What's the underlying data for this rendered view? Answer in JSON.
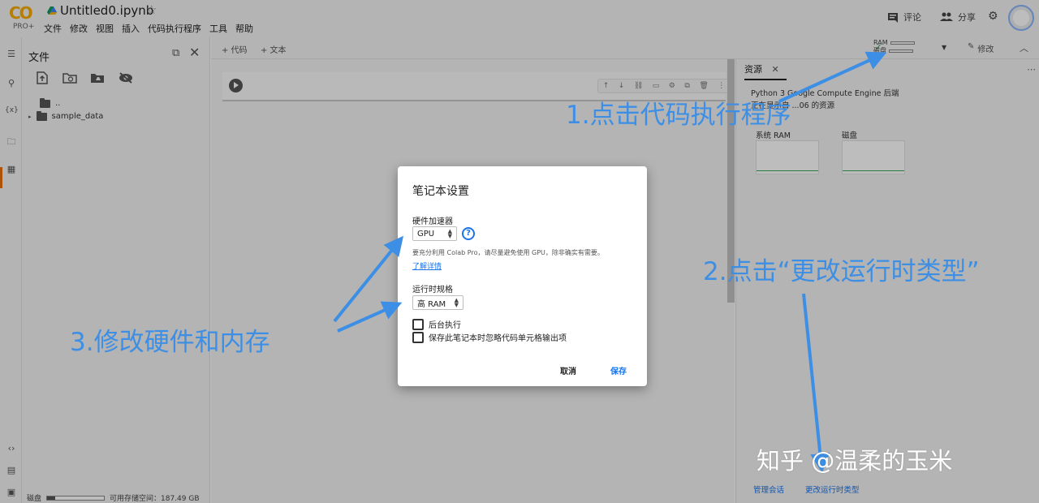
{
  "header": {
    "logo_text": "CO",
    "logo_badge": "PRO+",
    "doc_title": "Untitled0.ipynb",
    "menu": [
      "文件",
      "修改",
      "视图",
      "插入",
      "代码执行程序",
      "工具",
      "帮助"
    ],
    "comment_label": "评论",
    "share_label": "分享"
  },
  "toolbar": {
    "add_code": "+ 代码",
    "add_text": "+ 文本",
    "ram_label": "RAM",
    "disk_label": "磁盘",
    "edit_label": "修改"
  },
  "files_panel": {
    "title": "文件",
    "items": [
      {
        "label": ".."
      },
      {
        "label": "sample_data"
      }
    ],
    "disk_label": "磁盘",
    "disk_available": "可用存储空间：187.49 GB"
  },
  "resources_panel": {
    "tab_label": "资源",
    "description_line1": "Python 3 Google Compute Engine 后端",
    "description_line2": "正在显示自 ...06 的资源",
    "ram_label": "系统 RAM",
    "disk_label": "磁盘",
    "manage_sessions": "管理会话",
    "change_runtime": "更改运行时类型"
  },
  "dialog": {
    "title": "笔记本设置",
    "hw_label": "硬件加速器",
    "hw_value": "GPU",
    "note": "要充分利用 Colab Pro，请尽量避免使用 GPU，除非确实有需要。",
    "learn_more": "了解详情",
    "runtime_label": "运行时规格",
    "runtime_value": "高 RAM",
    "background_label": "后台执行",
    "omit_output_label": "保存此笔记本时忽略代码单元格输出项",
    "cancel_label": "取消",
    "save_label": "保存"
  },
  "annotations": {
    "step1": "1.点击代码执行程序",
    "step2": "2.点击“更改运行时类型”",
    "step3": "3.修改硬件和内存",
    "watermark": "知乎 @温柔的玉米",
    "color": "#3d8fe5"
  }
}
